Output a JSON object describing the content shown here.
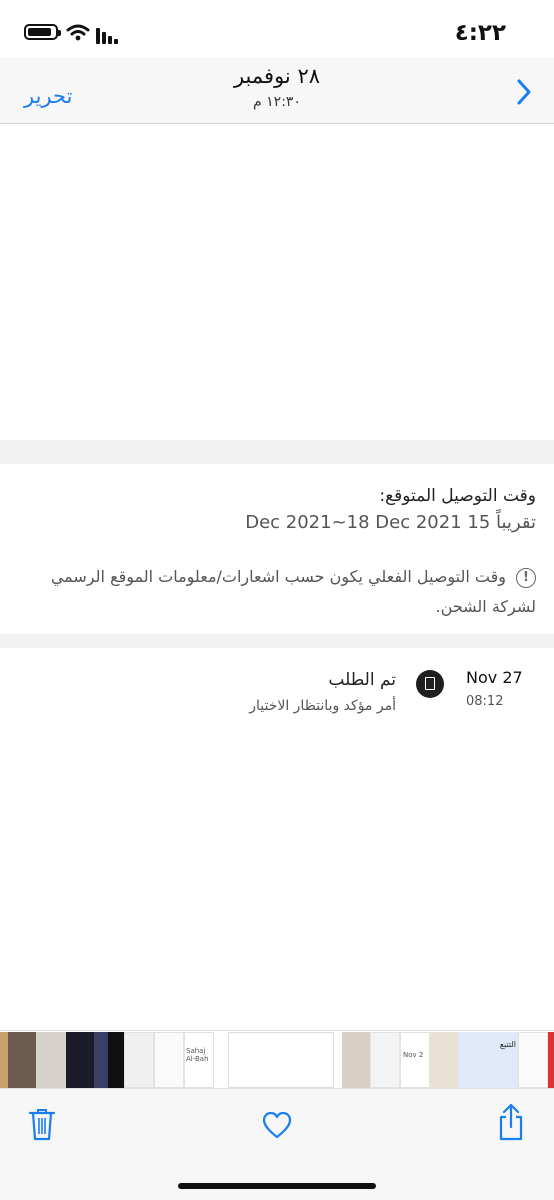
{
  "status_bar": {
    "time": "٤:٢٢"
  },
  "nav": {
    "edit_label": "تحرير",
    "title": "٢٨ نوفمبر",
    "subtitle": "١٢:٣٠ م"
  },
  "delivery": {
    "heading": "وقت التوصيل المتوقع:",
    "range": "تقريباً 15 Dec 2021~18 Dec 2021",
    "note": "وقت التوصيل الفعلي يكون حسب اشعارات/معلومات الموقع الرسمي لشركة الشحن."
  },
  "order_status": {
    "date": "Nov 27",
    "time": "08:12",
    "title": "تم الطلب",
    "description": "أمر مؤكد وبانتظار الاختيار"
  },
  "thumbnail_strip": {
    "thumb_texts": [
      "Sahaj Al-Bah",
      "Nov 2",
      "التتبع"
    ]
  },
  "colors": {
    "accent": "#1a7ef0",
    "separator": "#f2f2f2"
  }
}
